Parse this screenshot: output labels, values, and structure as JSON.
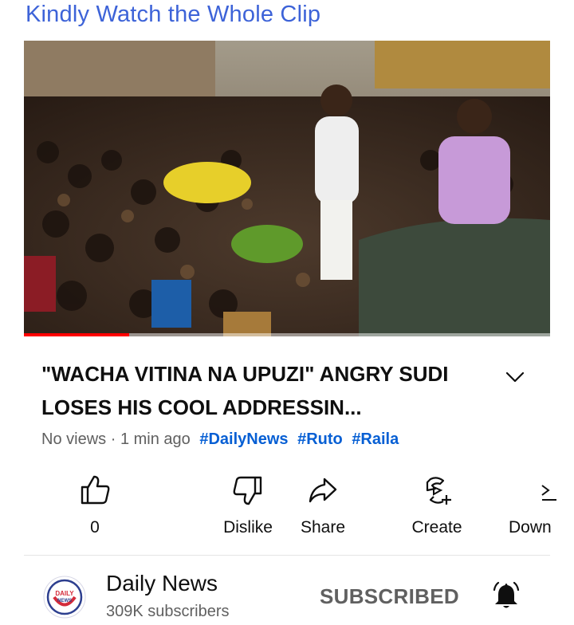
{
  "banner": {
    "text": "Kindly Watch the Whole Clip"
  },
  "video": {
    "title": "\"WACHA VITINA NA UPUZI\" ANGRY SUDI LOSES HIS COOL ADDRESSIN...",
    "progress": 0.2
  },
  "meta": {
    "views": "No views",
    "separator": "·",
    "age": "1 min ago",
    "hashtags": [
      "#DailyNews",
      "#Ruto",
      "#Raila"
    ]
  },
  "actions": {
    "like": {
      "label": "0",
      "icon": "thumbs-up-icon"
    },
    "dislike": {
      "label": "Dislike",
      "icon": "thumbs-down-icon"
    },
    "share": {
      "label": "Share",
      "icon": "share-icon"
    },
    "create": {
      "label": "Create",
      "icon": "create-icon"
    },
    "download": {
      "label": "Down",
      "icon": "download-icon"
    }
  },
  "channel": {
    "name": "Daily News",
    "subscribers": "309K subscribers",
    "avatar_text": "DAILY NEWS",
    "subscribe_state": "SUBSCRIBED"
  },
  "colors": {
    "banner": "#3d63d8",
    "hashtag": "#065fd4",
    "progress": "#ff0000",
    "secondary_text": "#606060"
  }
}
